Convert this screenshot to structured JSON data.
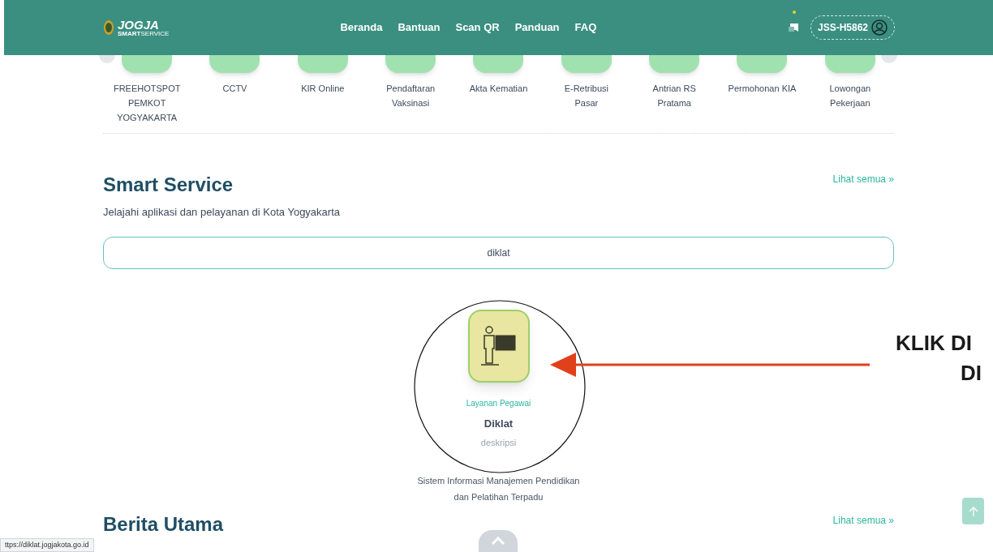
{
  "header": {
    "logo_title": "JOGJA",
    "logo_subtitle_bold": "SMART",
    "logo_subtitle": "SERVICE",
    "nav": [
      "Beranda",
      "Bantuan",
      "Scan QR",
      "Panduan",
      "FAQ"
    ],
    "notification_dot": true,
    "user_id": "JSS-H5862"
  },
  "apps": [
    {
      "label": "FREEHOTSPOT\nPEMKOT\nYOGYAKARTA"
    },
    {
      "label": "CCTV"
    },
    {
      "label": "KIR Online"
    },
    {
      "label": "Pendaftaran\nVaksinasi"
    },
    {
      "label": "Akta Kematian"
    },
    {
      "label": "E-Retribusi\nPasar"
    },
    {
      "label": "Antrian RS\nPratama"
    },
    {
      "label": "Permohonan KIA"
    },
    {
      "label": "Lowongan\nPekerjaan"
    }
  ],
  "smart_service": {
    "title": "Smart Service",
    "subtitle": "Jelajahi aplikasi dan pelayanan di Kota Yogyakarta",
    "see_all": "Lihat semua »",
    "search_value": "diklat",
    "result": {
      "category": "Layanan Pegawai",
      "name": "Diklat",
      "description_label": "deskripsi",
      "description": "Sistem Informasi Manajemen Pendidikan\ndan Pelatihan Terpadu"
    }
  },
  "news": {
    "title": "Berita Utama",
    "see_all": "Lihat semua »"
  },
  "annotation": {
    "lines": [
      "KLIK DI",
      "DI"
    ]
  },
  "status_url": "ttps://diklat.jogjakota.go.id"
}
